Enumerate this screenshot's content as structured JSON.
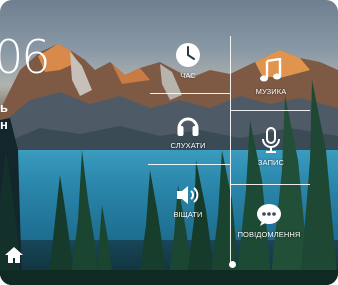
{
  "clock": {
    "time_fragment": "06",
    "line1_fragment": "ь",
    "line2_fragment": "н"
  },
  "menu": {
    "clock_label": "ЧАС",
    "music_label": "МУЗИКА",
    "listen_label": "СЛУХАТИ",
    "record_label": "ЗАПИС",
    "announce_label": "ВІЩАТИ",
    "messages_label": "ПОВІДОМЛЕННЯ"
  },
  "icons": {
    "clock": "clock-icon",
    "music": "music-note-icon",
    "listen": "headphones-icon",
    "record": "microphone-icon",
    "announce": "speaker-icon",
    "messages": "chat-bubble-icon",
    "home": "home-icon"
  },
  "pager": {
    "current_page": 1
  }
}
